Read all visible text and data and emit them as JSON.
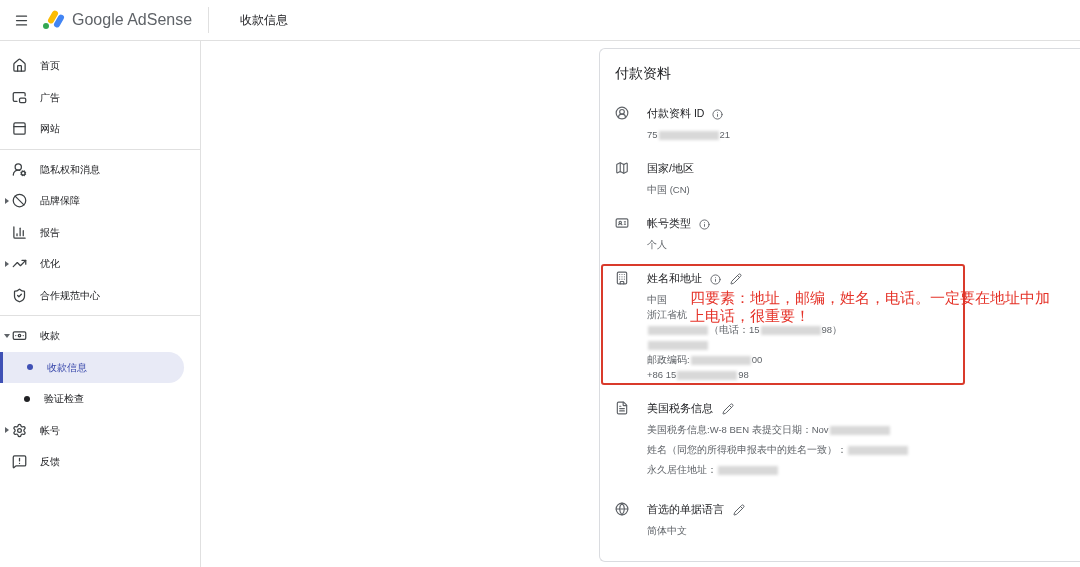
{
  "header": {
    "logo_text": "Google AdSense",
    "page_title": "收款信息"
  },
  "sidebar": {
    "groups": [
      [
        {
          "label": "首页",
          "selected": false
        },
        {
          "label": "广告",
          "selected": false
        },
        {
          "label": "网站",
          "selected": false
        }
      ],
      [
        {
          "label": "隐私权和消息",
          "selected": false
        },
        {
          "label": "品牌保障",
          "selected": false,
          "expanded": false
        },
        {
          "label": "报告",
          "selected": false
        },
        {
          "label": "优化",
          "selected": false,
          "expanded": false
        },
        {
          "label": "合作规范中心",
          "selected": false
        }
      ],
      [
        {
          "label": "收款",
          "selected": false,
          "expanded": true,
          "children": [
            {
              "label": "收款信息",
              "selected": true
            },
            {
              "label": "验证检查",
              "selected": false
            }
          ]
        },
        {
          "label": "帐号",
          "selected": false,
          "expanded": false
        },
        {
          "label": "反馈",
          "selected": false
        }
      ]
    ]
  },
  "card": {
    "title": "付款资料",
    "sections": [
      {
        "title": "付款资料 ID",
        "info": true,
        "editable": false,
        "lines": [
          [
            {
              "kind": "text",
              "text": "75"
            },
            {
              "kind": "redacted"
            },
            {
              "kind": "text",
              "text": "21"
            }
          ]
        ]
      },
      {
        "title": "国家/地区",
        "info": false,
        "editable": false,
        "lines": [
          [
            {
              "kind": "text",
              "text": "中国 (CN)"
            }
          ]
        ]
      },
      {
        "title": "帐号类型",
        "info": true,
        "editable": false,
        "lines": [
          [
            {
              "kind": "text",
              "text": "个人"
            }
          ]
        ]
      },
      {
        "title": "姓名和地址",
        "info": true,
        "editable": true,
        "lines": [
          [
            {
              "kind": "text",
              "text": "中国"
            }
          ],
          [
            {
              "kind": "text",
              "text": "浙江省杭"
            }
          ],
          [
            {
              "kind": "redacted"
            },
            {
              "kind": "text",
              "text": "（电话：15"
            },
            {
              "kind": "redacted"
            },
            {
              "kind": "text",
              "text": "98）"
            }
          ],
          [
            {
              "kind": "redacted"
            }
          ],
          [
            {
              "kind": "text",
              "text": "邮政编码:"
            },
            {
              "kind": "redacted"
            },
            {
              "kind": "text",
              "text": "00"
            }
          ],
          [
            {
              "kind": "text",
              "text": "+86 15"
            },
            {
              "kind": "redacted"
            },
            {
              "kind": "text",
              "text": "98"
            }
          ]
        ]
      },
      {
        "title": "美国税务信息",
        "info": false,
        "editable": true,
        "lines": [
          [
            {
              "kind": "text",
              "text": "美国税务信息:W-8 BEN 表提交日期：Nov"
            },
            {
              "kind": "redacted"
            }
          ],
          [
            {
              "kind": "text",
              "text": "姓名（同您的所得税申报表中的姓名一致）："
            },
            {
              "kind": "redacted"
            }
          ],
          [
            {
              "kind": "text",
              "text": "永久居住地址："
            },
            {
              "kind": "redacted"
            }
          ]
        ]
      },
      {
        "title": "首选的单据语言",
        "info": false,
        "editable": true,
        "lines": [
          [
            {
              "kind": "text",
              "text": "简体中文"
            }
          ]
        ]
      }
    ]
  },
  "annotation": {
    "lines": [
      "四要素：地址，邮编，姓名，电话。一定要在地址中加",
      "上电话，很重要！"
    ]
  }
}
